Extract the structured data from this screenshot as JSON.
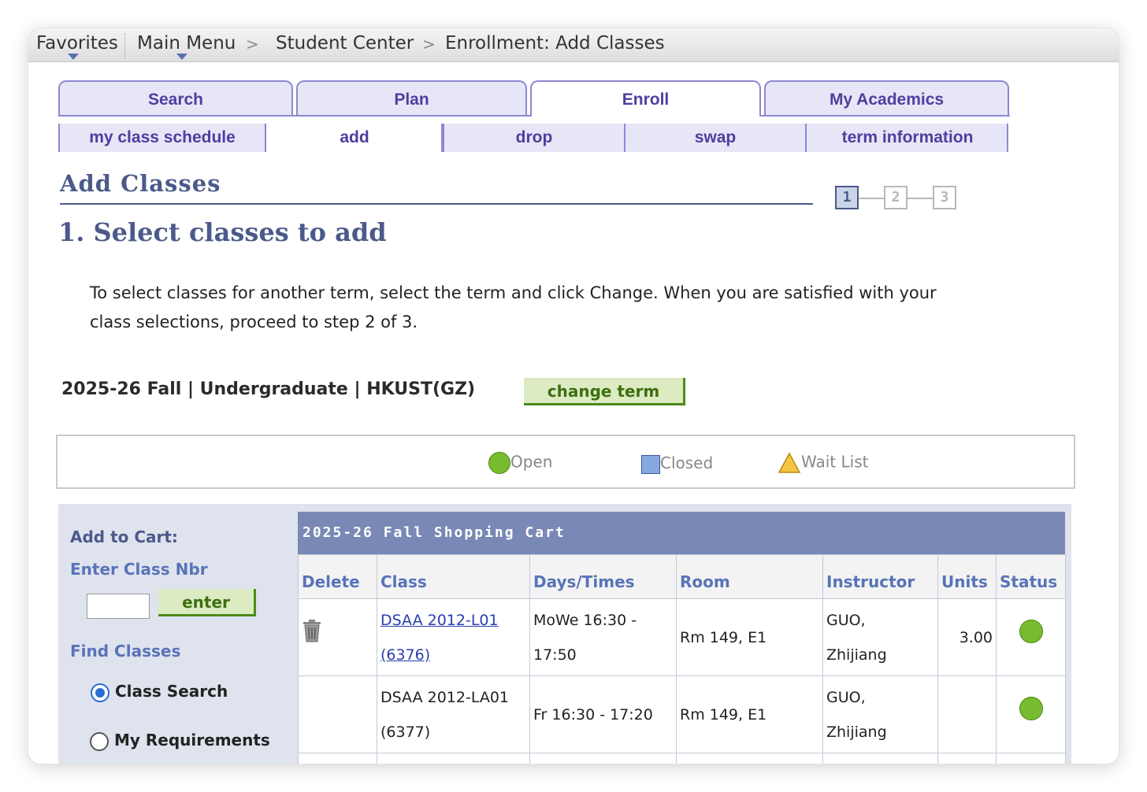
{
  "breadcrumb": {
    "favorites": "Favorites",
    "main_menu": "Main Menu",
    "student_center": "Student Center",
    "current": "Enrollment: Add Classes",
    "separator": ">"
  },
  "tabs": [
    {
      "label": "Search"
    },
    {
      "label": "Plan"
    },
    {
      "label": "Enroll"
    },
    {
      "label": "My Academics"
    }
  ],
  "subtabs": [
    {
      "label": "my class schedule"
    },
    {
      "label": "add"
    },
    {
      "label": "drop"
    },
    {
      "label": "swap"
    },
    {
      "label": "term information"
    }
  ],
  "page": {
    "title": "Add Classes",
    "steps": [
      "1",
      "2",
      "3"
    ],
    "step_heading": "1.  Select classes to add",
    "instructions": "To select classes for another term, select the term and click Change.  When you are satisfied with your class selections, proceed to step 2 of 3.",
    "term": "2025-26 Fall | Undergraduate | HKUST(GZ)",
    "change_term_label": "change term"
  },
  "legend": {
    "open": "Open",
    "closed": "Closed",
    "wait_list": "Wait List"
  },
  "sidebar": {
    "add_to_cart": "Add to Cart:",
    "enter_class_nbr": "Enter Class Nbr",
    "class_nbr_value": "",
    "enter_label": "enter",
    "find_classes": "Find Classes",
    "options": [
      {
        "label": "Class Search",
        "selected": true
      },
      {
        "label": "My Requirements",
        "selected": false
      }
    ]
  },
  "cart": {
    "title": "2025-26 Fall Shopping Cart",
    "columns": [
      "Delete",
      "Class",
      "Days/Times",
      "Room",
      "Instructor",
      "Units",
      "Status"
    ],
    "rows": [
      {
        "class_code": "DSAA 2012-L01",
        "class_nbr": "(6376)",
        "days_line1": "MoWe 16:30 -",
        "days_line2": "17:50",
        "room": "Rm 149, E1",
        "instructor_line1": "GUO,",
        "instructor_line2": "Zhijiang",
        "units": "3.00",
        "status": "Open",
        "deletable": true
      },
      {
        "class_code": "DSAA 2012-LA01",
        "class_nbr": "(6377)",
        "days_line1": "Fr 16:30 - 17:20",
        "days_line2": "",
        "room": "Rm 149, E1",
        "instructor_line1": "GUO,",
        "instructor_line2": "Zhijiang",
        "units": "",
        "status": "Open",
        "deletable": false
      }
    ]
  },
  "colors": {
    "tab_text": "#4f3ea0",
    "heading": "#4b5a8a",
    "open_status": "#77bb2f",
    "cart_header": "#7a88b6",
    "green_button": "#dcebc2"
  }
}
